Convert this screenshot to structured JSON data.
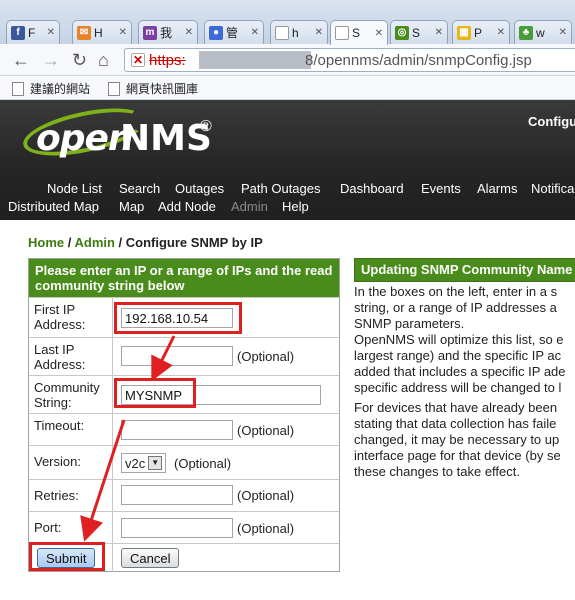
{
  "browser": {
    "tabs": [
      {
        "favicon": "facebook-icon",
        "color": "#3b5998",
        "glyph": "f",
        "title": "F"
      },
      {
        "favicon": "mail-icon",
        "color": "#e8832a",
        "glyph": "✉",
        "title": "H"
      },
      {
        "favicon": "m-icon",
        "color": "#7a3fa0",
        "glyph": "m",
        "title": "我"
      },
      {
        "favicon": "chat-icon",
        "color": "#3a6bd6",
        "glyph": "●",
        "title": "管"
      },
      {
        "favicon": "page-icon",
        "color": "#bbbbbb",
        "glyph": "",
        "title": "h"
      },
      {
        "favicon": "page-icon",
        "color": "#bbbbbb",
        "glyph": "",
        "title": "S"
      },
      {
        "favicon": "ring-icon",
        "color": "#4a8c1c",
        "glyph": "◎",
        "title": "S"
      },
      {
        "favicon": "grid-icon",
        "color": "#e8b51a",
        "glyph": "▦",
        "title": "P"
      },
      {
        "favicon": "leaf-icon",
        "color": "#4a9c3a",
        "glyph": "♣",
        "title": "w"
      }
    ],
    "url_scheme": "https:",
    "url_rest": "8/opennms/admin/snmpConfig.jsp",
    "bookmarks": [
      "建議的網站",
      "網頁快訊圖庫"
    ]
  },
  "header": {
    "logo_open": "open",
    "logo_nms": "NMS",
    "logo_reg": "®",
    "right_text": "Configu",
    "menu_row1": [
      "Node List",
      "Search",
      "Outages",
      "Path Outages",
      "Dashboard",
      "Events",
      "Alarms",
      "Notifica"
    ],
    "menu_row2": [
      "Distributed Map",
      "Map",
      "Add Node",
      "Admin",
      "Help"
    ]
  },
  "breadcrumb": {
    "home": "Home",
    "sep1": " / ",
    "admin": "Admin",
    "sep2": " / ",
    "current": "Configure SNMP by IP"
  },
  "form": {
    "heading": "Please enter an IP or a range of IPs and the read community string below",
    "first_ip_label": "First IP Address:",
    "first_ip_value": "192.168.10.54",
    "last_ip_label": "Last IP Address:",
    "last_ip_value": "",
    "community_label": "Community String:",
    "community_value": "MYSNMP",
    "timeout_label": "Timeout:",
    "timeout_value": "",
    "version_label": "Version:",
    "version_value": "v2c",
    "retries_label": "Retries:",
    "retries_value": "",
    "port_label": "Port:",
    "port_value": "",
    "optional": "(Optional)",
    "submit": "Submit",
    "cancel": "Cancel"
  },
  "info": {
    "heading": "Updating SNMP Community Name",
    "p1": "In the boxes on the left, enter in a s\nstring, or a range of IP addresses a\nSNMP parameters.",
    "p2": "OpenNMS will optimize this list, so e\nlargest range) and the specific IP ac\nadded that includes a specific IP ade\nspecific address will be changed to l",
    "p3": "For devices that have already been\nstating that data collection has faile\nchanged, it may be necessary to up\ninterface page for that device (by se\nthese changes to take effect."
  },
  "colors": {
    "header_bg": "#262626",
    "accent_green": "#4a8c1c",
    "highlight_red": "#e02020"
  }
}
